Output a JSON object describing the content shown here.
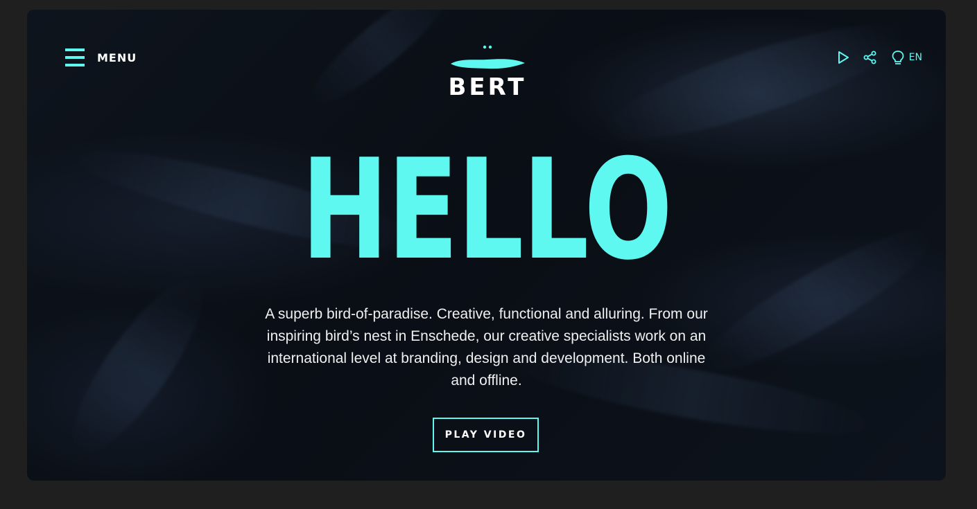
{
  "header": {
    "menu_label": "MENU",
    "logo_text": "BERT",
    "language": "EN",
    "icons": [
      "hamburger-icon",
      "play-icon",
      "share-icon",
      "lightbulb-icon"
    ]
  },
  "hero": {
    "title": "HELLO",
    "description": "A superb bird-of-paradise. Creative, functional and alluring. From our inspiring bird’s nest in Enschede, our creative specialists work on an international level at branding, design and development. Both online and offline.",
    "cta_label": "PLAY VIDEO"
  },
  "colors": {
    "accent": "#5ff8f0",
    "page_background": "#1f1f1f",
    "hero_background": "#0b1018",
    "text": "#ffffff"
  }
}
